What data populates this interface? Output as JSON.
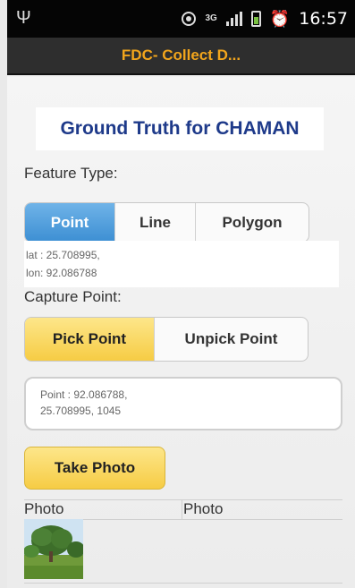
{
  "status_bar": {
    "time": "16:57",
    "network": "3G",
    "icons": [
      "usb-icon",
      "gps-icon",
      "signal-icon",
      "battery-icon",
      "alarm-icon"
    ]
  },
  "title_bar": {
    "title": "FDC- Collect D..."
  },
  "header": {
    "heading": "Ground Truth for CHAMAN"
  },
  "feature_type": {
    "label": "Feature Type:",
    "options": [
      "Point",
      "Line",
      "Polygon"
    ],
    "selected": "Point"
  },
  "coordinates": {
    "lat_line": "lat : 25.708995,",
    "lon_line": "lon: 92.086788"
  },
  "capture_point": {
    "label": "Capture Point:",
    "pick_label": "Pick Point",
    "unpick_label": "Unpick Point",
    "selected": "Pick Point"
  },
  "point_field": {
    "line1": "Point : 92.086788,",
    "line2": "25.708995,  1045"
  },
  "take_photo": {
    "label": "Take Photo"
  },
  "photo_table": {
    "headers": [
      "Photo",
      "Photo"
    ]
  },
  "colors": {
    "title_text": "#f2a51c",
    "heading_text": "#1e3a8a",
    "active_blue": "#3d8fd3",
    "active_yellow": "#f6cc44"
  }
}
